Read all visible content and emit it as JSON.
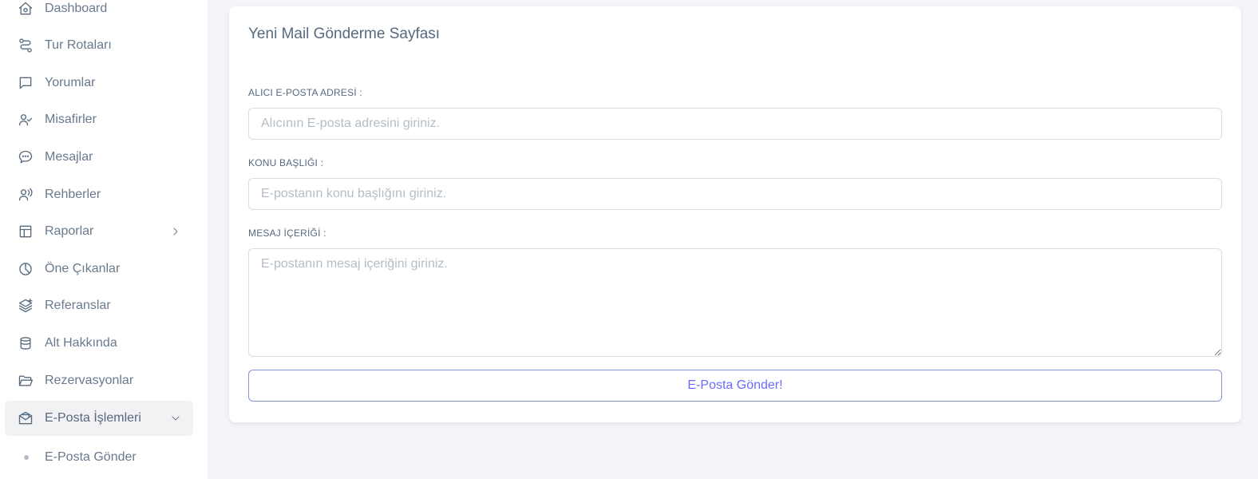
{
  "sidebar": {
    "items": [
      {
        "label": "Dashboard",
        "icon": "home-icon"
      },
      {
        "label": "Tur Rotaları",
        "icon": "route-icon"
      },
      {
        "label": "Yorumlar",
        "icon": "comment-icon"
      },
      {
        "label": "Misafirler",
        "icon": "user-check-icon"
      },
      {
        "label": "Mesajlar",
        "icon": "message-dots-icon"
      },
      {
        "label": "Rehberler",
        "icon": "user-voice-icon"
      },
      {
        "label": "Raporlar",
        "icon": "layout-icon"
      },
      {
        "label": "Öne Çıkanlar",
        "icon": "pie-chart-icon"
      },
      {
        "label": "Referanslar",
        "icon": "layer-plus-icon"
      },
      {
        "label": "Alt Hakkında",
        "icon": "cylinder-icon"
      },
      {
        "label": "Rezervasyonlar",
        "icon": "folder-open-icon"
      },
      {
        "label": "E-Posta İşlemleri",
        "icon": "envelope-open-icon"
      }
    ],
    "sub_items": [
      {
        "label": "E-Posta Gönder"
      }
    ]
  },
  "form": {
    "title": "Yeni Mail Gönderme Sayfası",
    "recipient_label": "ALICI E-POSTA ADRESİ :",
    "recipient_placeholder": "Alıcının E-posta adresini giriniz.",
    "subject_label": "KONU BAŞLIĞI :",
    "subject_placeholder": "E-postanın konu başlığını giriniz.",
    "body_label": "MESAJ İÇERİĞİ :",
    "body_placeholder": "E-postanın mesaj içeriğini giriniz.",
    "submit_label": "E-Posta Gönder!"
  },
  "colors": {
    "accent": "#696cff",
    "text": "#697a8d",
    "background": "#f5f5f9"
  }
}
